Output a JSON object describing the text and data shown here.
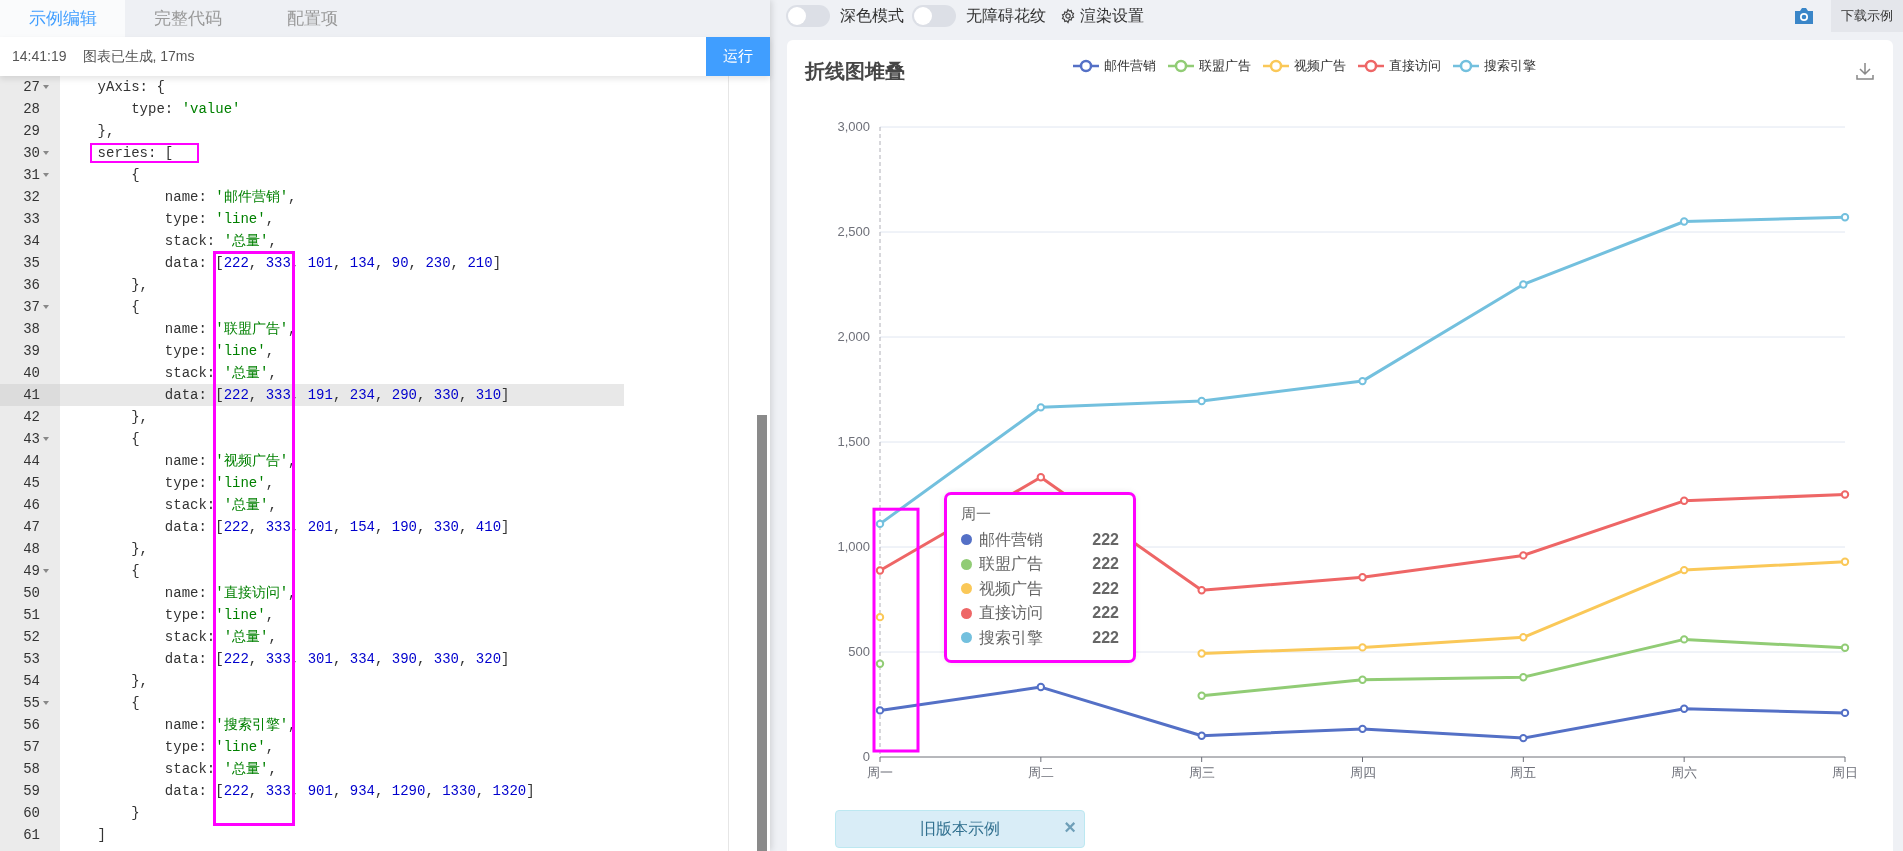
{
  "editor": {
    "tabs": [
      {
        "label": "示例编辑",
        "selected": true
      },
      {
        "label": "完整代码",
        "selected": false
      },
      {
        "label": "配置项",
        "selected": false
      }
    ],
    "status": {
      "time": "14:41:19",
      "message": "图表已生成, 17ms"
    },
    "run_button": "运行",
    "column_frame": true,
    "lines": [
      {
        "number": "27",
        "text": "    yAxis: {",
        "foldable": true,
        "current": false,
        "highlighted": false
      },
      {
        "number": "28",
        "text": "        type: 'value'",
        "foldable": false,
        "current": false,
        "highlighted": false
      },
      {
        "number": "29",
        "text": "    },",
        "foldable": false,
        "current": false,
        "highlighted": false
      },
      {
        "number": "30",
        "text": "    series: [",
        "foldable": true,
        "current": false,
        "highlighted": true
      },
      {
        "number": "31",
        "text": "        {",
        "foldable": true,
        "current": false,
        "highlighted": false
      },
      {
        "number": "32",
        "text": "            name: '邮件营销',",
        "foldable": false,
        "current": false,
        "highlighted": false
      },
      {
        "number": "33",
        "text": "            type: 'line',",
        "foldable": false,
        "current": false,
        "highlighted": false
      },
      {
        "number": "34",
        "text": "            stack: '总量',",
        "foldable": false,
        "current": false,
        "highlighted": false
      },
      {
        "number": "35",
        "text": "            data: [222, 333, 101, 134, 90, 230, 210]",
        "foldable": false,
        "current": false,
        "highlighted": false
      },
      {
        "number": "36",
        "text": "        },",
        "foldable": false,
        "current": false,
        "highlighted": false
      },
      {
        "number": "37",
        "text": "        {",
        "foldable": true,
        "current": false,
        "highlighted": false
      },
      {
        "number": "38",
        "text": "            name: '联盟广告',",
        "foldable": false,
        "current": false,
        "highlighted": false
      },
      {
        "number": "39",
        "text": "            type: 'line',",
        "foldable": false,
        "current": false,
        "highlighted": false
      },
      {
        "number": "40",
        "text": "            stack: '总量',",
        "foldable": false,
        "current": false,
        "highlighted": false
      },
      {
        "number": "41",
        "text": "            data: [222, 333, 191, 234, 290, 330, 310]",
        "foldable": false,
        "current": true,
        "highlighted": false
      },
      {
        "number": "42",
        "text": "        },",
        "foldable": false,
        "current": false,
        "highlighted": false
      },
      {
        "number": "43",
        "text": "        {",
        "foldable": true,
        "current": false,
        "highlighted": false
      },
      {
        "number": "44",
        "text": "            name: '视频广告',",
        "foldable": false,
        "current": false,
        "highlighted": false
      },
      {
        "number": "45",
        "text": "            type: 'line',",
        "foldable": false,
        "current": false,
        "highlighted": false
      },
      {
        "number": "46",
        "text": "            stack: '总量',",
        "foldable": false,
        "current": false,
        "highlighted": false
      },
      {
        "number": "47",
        "text": "            data: [222, 333, 201, 154, 190, 330, 410]",
        "foldable": false,
        "current": false,
        "highlighted": false
      },
      {
        "number": "48",
        "text": "        },",
        "foldable": false,
        "current": false,
        "highlighted": false
      },
      {
        "number": "49",
        "text": "        {",
        "foldable": true,
        "current": false,
        "highlighted": false
      },
      {
        "number": "50",
        "text": "            name: '直接访问',",
        "foldable": false,
        "current": false,
        "highlighted": false
      },
      {
        "number": "51",
        "text": "            type: 'line',",
        "foldable": false,
        "current": false,
        "highlighted": false
      },
      {
        "number": "52",
        "text": "            stack: '总量',",
        "foldable": false,
        "current": false,
        "highlighted": false
      },
      {
        "number": "53",
        "text": "            data: [222, 333, 301, 334, 390, 330, 320]",
        "foldable": false,
        "current": false,
        "highlighted": false
      },
      {
        "number": "54",
        "text": "        },",
        "foldable": false,
        "current": false,
        "highlighted": false
      },
      {
        "number": "55",
        "text": "        {",
        "foldable": true,
        "current": false,
        "highlighted": false
      },
      {
        "number": "56",
        "text": "            name: '搜索引擎',",
        "foldable": false,
        "current": false,
        "highlighted": false
      },
      {
        "number": "57",
        "text": "            type: 'line',",
        "foldable": false,
        "current": false,
        "highlighted": false
      },
      {
        "number": "58",
        "text": "            stack: '总量',",
        "foldable": false,
        "current": false,
        "highlighted": false
      },
      {
        "number": "59",
        "text": "            data: [222, 333, 901, 934, 1290, 1330, 1320]",
        "foldable": false,
        "current": false,
        "highlighted": false
      },
      {
        "number": "60",
        "text": "        }",
        "foldable": false,
        "current": false,
        "highlighted": false
      },
      {
        "number": "61",
        "text": "    ]",
        "foldable": false,
        "current": false,
        "highlighted": false
      }
    ]
  },
  "toolbar": {
    "toggles": [
      {
        "label": "深色模式",
        "on": false
      },
      {
        "label": "无障碍花纹",
        "on": false
      }
    ],
    "render_settings": "渲染设置",
    "download_button": "下载示例"
  },
  "chart": {
    "chart_data": {
      "type": "line",
      "title": "折线图堆叠",
      "grid": true,
      "legend": true,
      "categories": [
        "周一",
        "周二",
        "周三",
        "周四",
        "周五",
        "周六",
        "周日"
      ],
      "series": [
        {
          "name": "邮件营销",
          "color": "#5470c6",
          "marker": "circle",
          "values": [
            222,
            333,
            101,
            134,
            90,
            230,
            210
          ]
        },
        {
          "name": "联盟广告",
          "color": "#91cc75",
          "marker": "circle",
          "values": [
            444,
            null,
            292,
            368,
            380,
            560,
            520
          ]
        },
        {
          "name": "视频广告",
          "color": "#fac858",
          "marker": "circle",
          "values": [
            666,
            null,
            493,
            522,
            570,
            890,
            930
          ]
        },
        {
          "name": "直接访问",
          "color": "#ee6666",
          "marker": "circle",
          "values": [
            888,
            1332,
            794,
            856,
            960,
            1220,
            1250
          ]
        },
        {
          "name": "搜索引擎",
          "color": "#73c0de",
          "marker": "circle",
          "values": [
            1110,
            1665,
            1695,
            1790,
            2250,
            2550,
            2570
          ]
        }
      ],
      "ylim": [
        0,
        3000
      ],
      "yticks": [
        0,
        500,
        {
          "value": 1000,
          "label": "1,000"
        },
        {
          "value": 1500,
          "label": "1,500"
        },
        {
          "value": 2000,
          "label": "2,000"
        },
        {
          "value": 2500,
          "label": "2,500"
        },
        {
          "value": 3000,
          "label": "3,000"
        }
      ]
    },
    "axis_pointer": true,
    "tooltip": {
      "title": "周一",
      "highlighted": true,
      "rows": [
        {
          "name": "邮件营销",
          "value": "222",
          "color": "#5470c6"
        },
        {
          "name": "联盟广告",
          "value": "222",
          "color": "#91cc75"
        },
        {
          "name": "视频广告",
          "value": "222",
          "color": "#fac858"
        },
        {
          "name": "直接访问",
          "value": "222",
          "color": "#ee6666"
        },
        {
          "name": "搜索引擎",
          "value": "222",
          "color": "#73c0de"
        }
      ]
    }
  },
  "banner": {
    "text": "旧版本示例",
    "close": "×"
  }
}
